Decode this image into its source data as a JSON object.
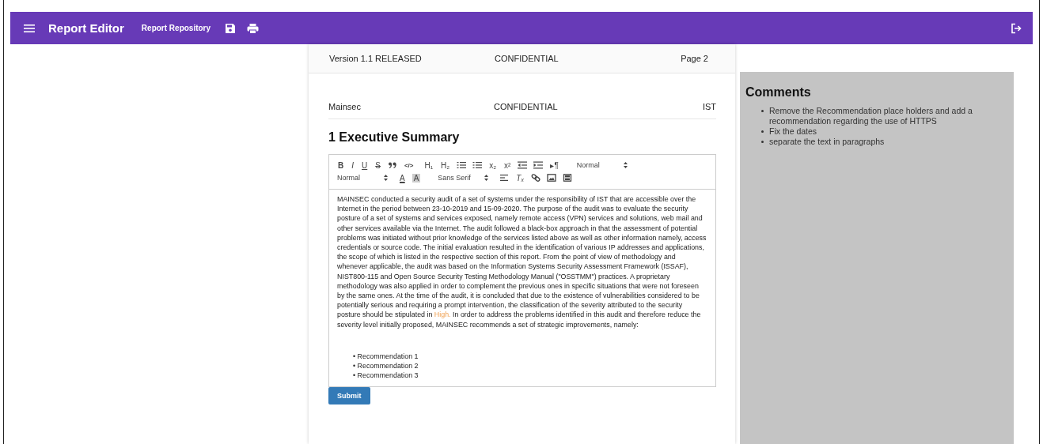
{
  "app_bar": {
    "title": "Report Editor",
    "link": "Report Repository"
  },
  "page_header": {
    "left": "Version 1.1 RELEASED",
    "center": "CONFIDENTIAL",
    "right": "Page 2"
  },
  "doc_header": {
    "left": "Mainsec",
    "center": "CONFIDENTIAL",
    "right": "IST"
  },
  "section_title": "1 Executive Summary",
  "toolbar": [
    [
      {
        "kind": "text",
        "label": "B"
      },
      {
        "kind": "text",
        "label": "I"
      },
      {
        "kind": "text",
        "label": "U"
      },
      {
        "kind": "text",
        "label": "S"
      },
      {
        "kind": "icon"
      },
      {
        "kind": "text",
        "label": "</>"
      },
      {
        "kind": "text",
        "label": "H₁"
      },
      {
        "kind": "text",
        "label": "H₂"
      },
      {
        "kind": "icon"
      },
      {
        "kind": "icon"
      },
      {
        "kind": "text",
        "label": "x₂"
      },
      {
        "kind": "text",
        "label": "x²"
      },
      {
        "kind": "icon"
      },
      {
        "kind": "icon"
      },
      {
        "kind": "text",
        "label": "▸¶"
      },
      {
        "kind": "select",
        "label": "Normal"
      }
    ],
    [
      {
        "kind": "select",
        "label": "Normal"
      },
      {
        "kind": "text",
        "label": "A"
      },
      {
        "kind": "text",
        "label": "A"
      },
      {
        "kind": "select",
        "label": "Sans Serif"
      },
      {
        "kind": "icon"
      },
      {
        "kind": "text",
        "label": "Tₓ"
      },
      {
        "kind": "icon"
      },
      {
        "kind": "icon"
      },
      {
        "kind": "icon"
      }
    ]
  ],
  "paragraph": [
    {
      "text": "MAINSEC conducted a security audit of a set of systems under the responsibility of IST that are accessible over the Internet in the period between 23-10-2019 and 15-09-2020. The purpose of the audit was to evaluate the security posture of a set of systems and services exposed, namely remote access (VPN) services and solutions, web mail and other services available via the Internet. The audit followed a black-box approach in that the assessment of potential problems was initiated without prior knowledge of the services listed above as well as other information namely, access credentials or source code. The initial evaluation resulted in the identification of various IP addresses and applications, the scope of which is listed in the respective section of this report. From the point of view of methodology and whenever applicable, the audit was based on the Information Systems Security Assessment Framework (ISSAF), NIST800-115 and Open Source Security Testing Methodology Manual (\"OSSTMM\") practices. A proprietary methodology was also applied in order to complement the previous ones in specific situations that were not foreseen by the same ones. At the time of the audit, it is concluded that due to the existence of vulnerabilities considered to be potentially serious and requiring a prompt intervention, the classification of the severity attributed to the security posture should be stipulated in ",
      "highlight": false
    },
    {
      "text": "High.",
      "highlight": true
    },
    {
      "text": " In order to address the problems identified in this audit and therefore reduce the severity level initially proposed, MAINSEC recommends a set of strategic improvements, namely:",
      "highlight": false
    }
  ],
  "recommendations": [
    "• Recommendation 1",
    "• Recommendation 2",
    "• Recommendation 3"
  ],
  "submit": "Submit",
  "comments": {
    "title": "Comments",
    "items": [
      "Remove the Recommendation place holders and add a recommendation regarding the use of HTTPS",
      "Fix the dates",
      "separate the text in paragraphs"
    ]
  }
}
